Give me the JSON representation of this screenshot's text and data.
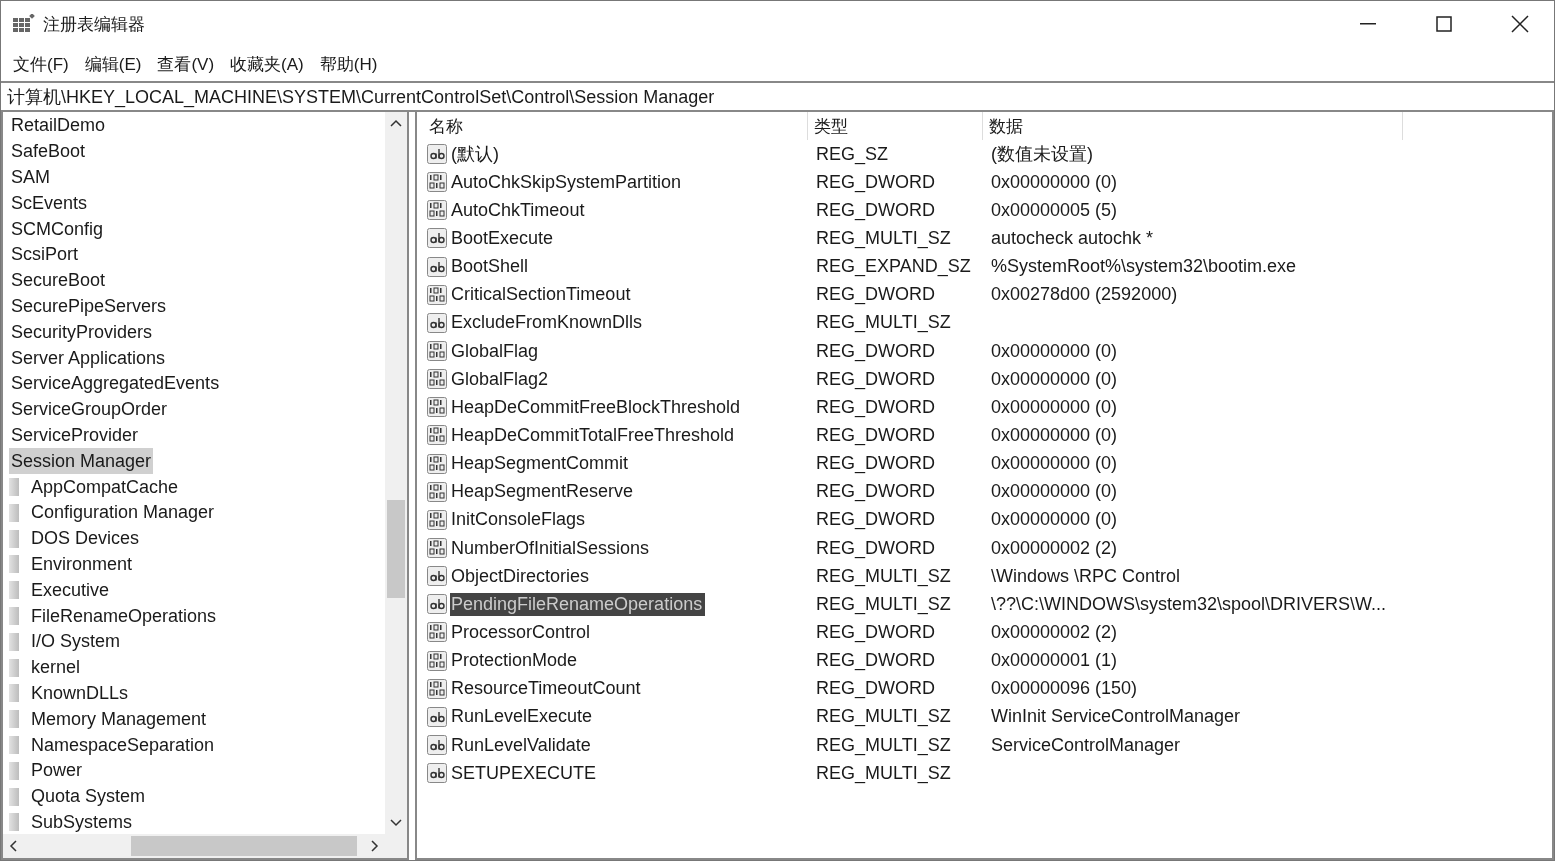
{
  "window": {
    "title": "注册表编辑器"
  },
  "menu": [
    "文件(F)",
    "编辑(E)",
    "查看(V)",
    "收藏夹(A)",
    "帮助(H)"
  ],
  "address": "计算机\\HKEY_LOCAL_MACHINE\\SYSTEM\\CurrentControlSet\\Control\\Session Manager",
  "tree": [
    {
      "label": "RetailDemo",
      "selected": false
    },
    {
      "label": "SafeBoot",
      "selected": false
    },
    {
      "label": "SAM",
      "selected": false
    },
    {
      "label": "ScEvents",
      "selected": false
    },
    {
      "label": "SCMConfig",
      "selected": false
    },
    {
      "label": "ScsiPort",
      "selected": false
    },
    {
      "label": "SecureBoot",
      "selected": false
    },
    {
      "label": "SecurePipeServers",
      "selected": false
    },
    {
      "label": "SecurityProviders",
      "selected": false
    },
    {
      "label": "Server Applications",
      "selected": false
    },
    {
      "label": "ServiceAggregatedEvents",
      "selected": false
    },
    {
      "label": "ServiceGroupOrder",
      "selected": false
    },
    {
      "label": "ServiceProvider",
      "selected": false
    },
    {
      "label": "Session Manager",
      "selected": true,
      "children": [
        {
          "label": "AppCompatCache",
          "selected": false
        },
        {
          "label": "Configuration Manager",
          "selected": false
        },
        {
          "label": "DOS Devices",
          "selected": false
        },
        {
          "label": "Environment",
          "selected": false
        },
        {
          "label": "Executive",
          "selected": false
        },
        {
          "label": "FileRenameOperations",
          "selected": false
        },
        {
          "label": "I/O System",
          "selected": false
        },
        {
          "label": "kernel",
          "selected": false
        },
        {
          "label": "KnownDLLs",
          "selected": false
        },
        {
          "label": "Memory Management",
          "selected": false
        },
        {
          "label": "NamespaceSeparation",
          "selected": false
        },
        {
          "label": "Power",
          "selected": false
        },
        {
          "label": "Quota System",
          "selected": false
        },
        {
          "label": "SubSystems",
          "selected": false
        }
      ]
    }
  ],
  "table": {
    "columns": [
      "名称",
      "类型",
      "数据"
    ],
    "rows": [
      {
        "kind": "string",
        "name": "(默认)",
        "type": "REG_SZ",
        "data": "(数值未设置)",
        "selected": false
      },
      {
        "kind": "binary",
        "name": "AutoChkSkipSystemPartition",
        "type": "REG_DWORD",
        "data": "0x00000000 (0)",
        "selected": false
      },
      {
        "kind": "binary",
        "name": "AutoChkTimeout",
        "type": "REG_DWORD",
        "data": "0x00000005 (5)",
        "selected": false
      },
      {
        "kind": "string",
        "name": "BootExecute",
        "type": "REG_MULTI_SZ",
        "data": "autocheck autochk *",
        "selected": false
      },
      {
        "kind": "string",
        "name": "BootShell",
        "type": "REG_EXPAND_SZ",
        "data": "%SystemRoot%\\system32\\bootim.exe",
        "selected": false
      },
      {
        "kind": "binary",
        "name": "CriticalSectionTimeout",
        "type": "REG_DWORD",
        "data": "0x00278d00 (2592000)",
        "selected": false
      },
      {
        "kind": "string",
        "name": "ExcludeFromKnownDlls",
        "type": "REG_MULTI_SZ",
        "selected": false
      },
      {
        "kind": "binary",
        "name": "GlobalFlag",
        "type": "REG_DWORD",
        "data": "0x00000000 (0)",
        "selected": false
      },
      {
        "kind": "binary",
        "name": "GlobalFlag2",
        "type": "REG_DWORD",
        "data": "0x00000000 (0)",
        "selected": false
      },
      {
        "kind": "binary",
        "name": "HeapDeCommitFreeBlockThreshold",
        "type": "REG_DWORD",
        "data": "0x00000000 (0)",
        "selected": false
      },
      {
        "kind": "binary",
        "name": "HeapDeCommitTotalFreeThreshold",
        "type": "REG_DWORD",
        "data": "0x00000000 (0)",
        "selected": false
      },
      {
        "kind": "binary",
        "name": "HeapSegmentCommit",
        "type": "REG_DWORD",
        "data": "0x00000000 (0)",
        "selected": false
      },
      {
        "kind": "binary",
        "name": "HeapSegmentReserve",
        "type": "REG_DWORD",
        "data": "0x00000000 (0)",
        "selected": false
      },
      {
        "kind": "binary",
        "name": "InitConsoleFlags",
        "type": "REG_DWORD",
        "data": "0x00000000 (0)",
        "selected": false
      },
      {
        "kind": "binary",
        "name": "NumberOfInitialSessions",
        "type": "REG_DWORD",
        "data": "0x00000002 (2)",
        "selected": false
      },
      {
        "kind": "string",
        "name": "ObjectDirectories",
        "type": "REG_MULTI_SZ",
        "data": "\\Windows \\RPC Control",
        "selected": false
      },
      {
        "kind": "string",
        "name": "PendingFileRenameOperations",
        "type": "REG_MULTI_SZ",
        "data": "\\??\\C:\\WINDOWS\\system32\\spool\\DRIVERS\\W...",
        "selected": true
      },
      {
        "kind": "binary",
        "name": "ProcessorControl",
        "type": "REG_DWORD",
        "data": "0x00000002 (2)",
        "selected": false
      },
      {
        "kind": "binary",
        "name": "ProtectionMode",
        "type": "REG_DWORD",
        "data": "0x00000001 (1)",
        "selected": false
      },
      {
        "kind": "binary",
        "name": "ResourceTimeoutCount",
        "type": "REG_DWORD",
        "data": "0x00000096 (150)",
        "selected": false
      },
      {
        "kind": "string",
        "name": "RunLevelExecute",
        "type": "REG_MULTI_SZ",
        "data": "WinInit ServiceControlManager",
        "selected": false
      },
      {
        "kind": "string",
        "name": "RunLevelValidate",
        "type": "REG_MULTI_SZ",
        "data": "ServiceControlManager",
        "selected": false
      },
      {
        "kind": "string",
        "name": "SETUPEXECUTE",
        "type": "REG_MULTI_SZ",
        "selected": false
      }
    ]
  }
}
